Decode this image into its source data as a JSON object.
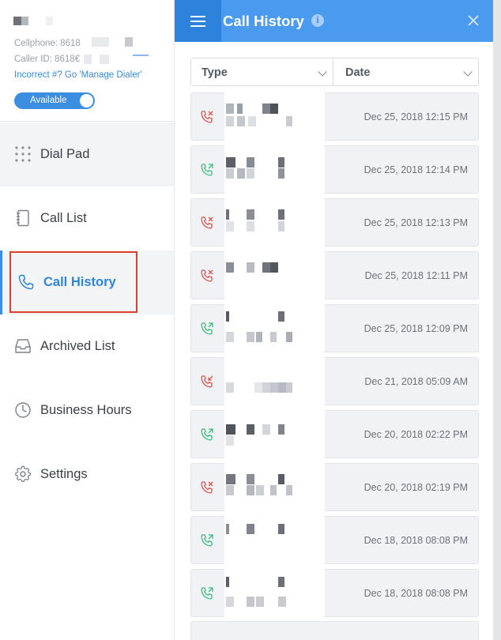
{
  "sidebar": {
    "cellphone_label": "Cellphone: 8618",
    "callerid_label": "Caller ID: 8618€",
    "incorrect_link": "Incorrect #? Go 'Manage Dialer'",
    "status_toggle": "Available",
    "nav": [
      {
        "label": "Dial Pad",
        "icon": "dialpad-icon"
      },
      {
        "label": "Call List",
        "icon": "notebook-icon"
      },
      {
        "label": "Call History",
        "icon": "phone-icon",
        "active": true
      },
      {
        "label": "Archived List",
        "icon": "inbox-icon"
      },
      {
        "label": "Business Hours",
        "icon": "clock-icon"
      },
      {
        "label": "Settings",
        "icon": "gear-icon"
      }
    ]
  },
  "header": {
    "title": "Call History",
    "info_icon": "i"
  },
  "filters": {
    "type_label": "Type",
    "date_label": "Date"
  },
  "calls": [
    {
      "date": "Dec 25, 2018 12:15 PM",
      "status": "missed",
      "icon": "phone-missed-icon"
    },
    {
      "date": "Dec 25, 2018 12:14 PM",
      "status": "outgoing",
      "icon": "phone-outgoing-icon"
    },
    {
      "date": "Dec 25, 2018 12:13 PM",
      "status": "missed",
      "icon": "phone-missed-icon"
    },
    {
      "date": "Dec 25, 2018 12:11 PM",
      "status": "missed",
      "icon": "phone-missed-icon"
    },
    {
      "date": "Dec 25, 2018 12:09 PM",
      "status": "outgoing",
      "icon": "phone-outgoing-icon"
    },
    {
      "date": "Dec 21, 2018 05:09 AM",
      "status": "missed-incoming",
      "icon": "phone-incoming-missed-icon"
    },
    {
      "date": "Dec 20, 2018 02:22 PM",
      "status": "outgoing",
      "icon": "phone-outgoing-icon"
    },
    {
      "date": "Dec 20, 2018 02:19 PM",
      "status": "missed",
      "icon": "phone-missed-icon"
    },
    {
      "date": "Dec 18, 2018 08:08 PM",
      "status": "outgoing",
      "icon": "phone-outgoing-icon"
    },
    {
      "date": "Dec 18, 2018 08:08 PM",
      "status": "outgoing",
      "icon": "phone-outgoing-icon"
    }
  ],
  "colors": {
    "accent": "#4a9bf0",
    "missed": "#e0534a",
    "outgoing": "#3bbf7a"
  }
}
